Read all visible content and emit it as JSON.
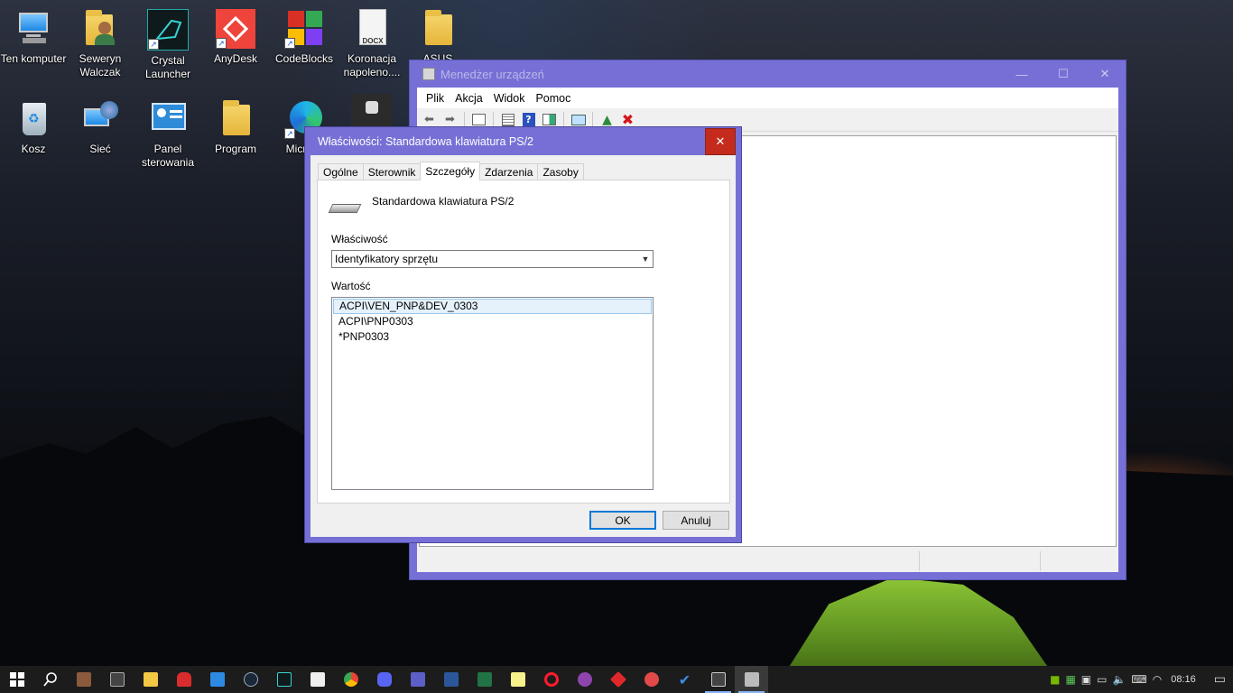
{
  "desktop": {
    "icons": [
      {
        "label": "Ten komputer",
        "icon": "this-pc-icon"
      },
      {
        "label": "Seweryn Walczak",
        "icon": "user-folder-icon"
      },
      {
        "label": "Crystal Launcher",
        "icon": "crystal-launcher-icon"
      },
      {
        "label": "AnyDesk",
        "icon": "anydesk-icon"
      },
      {
        "label": "CodeBlocks",
        "icon": "codeblocks-icon"
      },
      {
        "label": "Koronacja napoleno....",
        "icon": "docx-file-icon"
      },
      {
        "label": "ASUS",
        "icon": "folder-icon"
      },
      {
        "label": "Kosz",
        "icon": "recycle-bin-icon"
      },
      {
        "label": "Sieć",
        "icon": "network-icon"
      },
      {
        "label": "Panel sterowania",
        "icon": "control-panel-icon"
      },
      {
        "label": "Program",
        "icon": "folder-icon"
      },
      {
        "label": "Micr Ed",
        "icon": "edge-icon"
      }
    ],
    "docx_badge": "DOCX"
  },
  "device_manager": {
    "title": "Menedżer urządzeń",
    "window_controls": {
      "minimize": "—",
      "maximize": "☐",
      "close": "✕"
    },
    "menu": [
      "Plik",
      "Akcja",
      "Widok",
      "Pomoc"
    ],
    "toolbar": [
      "back-arrow-icon",
      "forward-arrow-icon",
      "properties-sheet-icon",
      "list-view-icon",
      "help-icon",
      "show-hidden-icon",
      "scan-hardware-icon",
      "update-driver-icon",
      "uninstall-icon"
    ]
  },
  "properties_dialog": {
    "title": "Właściwości: Standardowa klawiatura PS/2",
    "close": "✕",
    "tabs": [
      "Ogólne",
      "Sterownik",
      "Szczegóły",
      "Zdarzenia",
      "Zasoby"
    ],
    "active_tab": "Szczegóły",
    "device_name": "Standardowa klawiatura PS/2",
    "property_label": "Właściwość",
    "property_selected": "Identyfikatory sprzętu",
    "value_label": "Wartość",
    "values": [
      "ACPI\\VEN_PNP&DEV_0303",
      "ACPI\\PNP0303",
      "*PNP0303"
    ],
    "ok_label": "OK",
    "cancel_label": "Anuluj"
  },
  "taskbar": {
    "apps": [
      "start-icon",
      "search-icon",
      "avatar-app-icon",
      "calculator-icon",
      "file-explorer-icon",
      "among-us-icon",
      "vscode-icon",
      "steam-icon",
      "crystal-launcher-icon",
      "7zip-icon",
      "chrome-icon",
      "discord-icon",
      "teams-icon",
      "word-icon",
      "excel-icon",
      "notepad-icon",
      "opera-icon",
      "github-desktop-icon",
      "app-red-icon",
      "mail-icon",
      "todo-icon",
      "explorer-window-icon",
      "device-manager-icon"
    ],
    "clock": "08:16",
    "tray": [
      "nvidia-icon",
      "network-activity-icon",
      "camera-icon",
      "monitor-icon",
      "volume-icon",
      "input-icon",
      "wifi-icon"
    ]
  },
  "colors": {
    "window_frame": "#7670d6",
    "close_red": "#c42b1c",
    "selection": "#e5f1fb",
    "taskbar": "#1c1c1c"
  }
}
